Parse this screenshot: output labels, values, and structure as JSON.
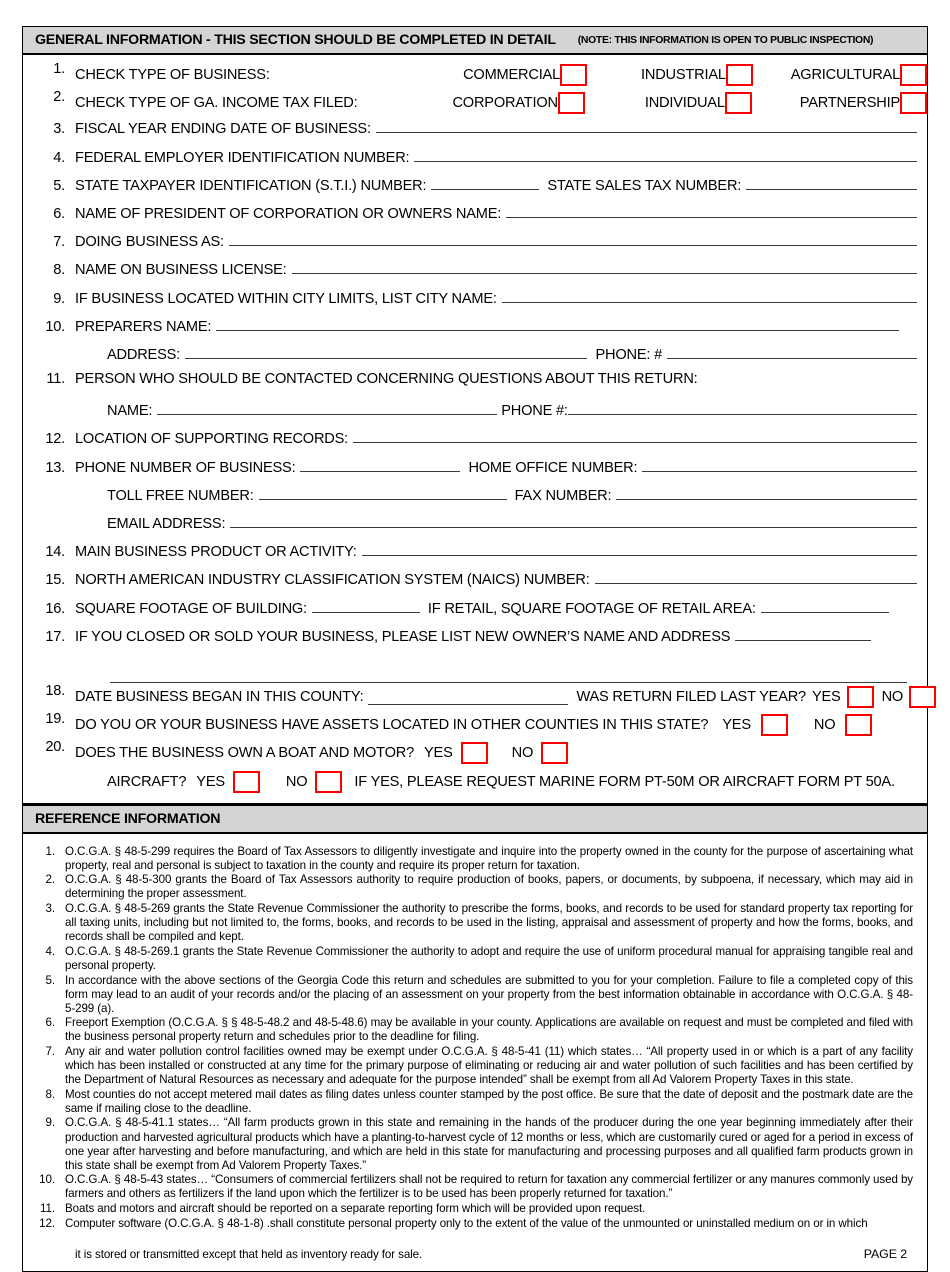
{
  "general_information": {
    "header_title": "GENERAL INFORMATION - THIS SECTION SHOULD BE COMPLETED IN DETAIL",
    "header_note": "(NOTE: THIS INFORMATION IS OPEN TO PUBLIC INSPECTION)",
    "items": {
      "n1": "1.",
      "n2": "2.",
      "n3": "3.",
      "n4": "4.",
      "n5": "5.",
      "n6": "6.",
      "n7": "7.",
      "n8": "8.",
      "n9": "9.",
      "n10": "10.",
      "n11": "11.",
      "n12": "12.",
      "n13": "13.",
      "n14": "14.",
      "n15": "15.",
      "n16": "16.",
      "n17": "17.",
      "n18": "18.",
      "n19": "19.",
      "n20": "20."
    },
    "labels": {
      "business_type": "CHECK TYPE OF BUSINESS:",
      "commercial": "COMMERCIAL",
      "industrial": "INDUSTRIAL",
      "agricultural": "AGRICULTURAL",
      "income_tax_type": "CHECK TYPE OF GA. INCOME TAX FILED:",
      "corporation": "CORPORATION",
      "individual": "INDIVIDUAL",
      "partnership": "PARTNERSHIP",
      "fiscal_year": "FISCAL YEAR ENDING DATE OF BUSINESS:",
      "fein": "FEDERAL EMPLOYER IDENTIFICATION NUMBER:",
      "sti": "STATE TAXPAYER IDENTIFICATION (S.T.I.) NUMBER:",
      "state_sales_tax": "STATE SALES TAX NUMBER:",
      "president_name": "NAME OF PRESIDENT OF CORPORATION OR OWNERS NAME:",
      "dba": "DOING BUSINESS AS:",
      "business_license_name": "NAME ON BUSINESS LICENSE:",
      "city_limits": "IF BUSINESS LOCATED WITHIN CITY LIMITS, LIST CITY NAME:",
      "preparers_name": "PREPARERS NAME:",
      "address": "ADDRESS:",
      "phone_hash": "PHONE: #",
      "contact_person": "PERSON WHO SHOULD BE CONTACTED CONCERNING QUESTIONS ABOUT THIS RETURN:",
      "name": "NAME:",
      "phone_num": "PHONE #:",
      "records_location": "LOCATION OF SUPPORTING RECORDS:",
      "business_phone": "PHONE NUMBER OF BUSINESS:",
      "home_office": "HOME OFFICE NUMBER:",
      "toll_free": "TOLL FREE NUMBER:",
      "fax": "FAX NUMBER:",
      "email": "EMAIL ADDRESS:",
      "main_product": "MAIN BUSINESS PRODUCT OR ACTIVITY:",
      "naics": "NORTH AMERICAN INDUSTRY CLASSIFICATION SYSTEM (NAICS) NUMBER:",
      "square_footage": "SQUARE FOOTAGE OF BUILDING:",
      "retail_footage": "IF RETAIL, SQUARE FOOTAGE OF RETAIL AREA:",
      "closed_sold": "IF YOU CLOSED OR SOLD YOUR BUSINESS, PLEASE LIST NEW OWNER’S NAME AND ADDRESS",
      "date_began": "DATE BUSINESS BEGAN IN THIS COUNTY:",
      "return_filed_last_year": "WAS RETURN FILED LAST YEAR?",
      "assets_other_counties": "DO YOU OR YOUR BUSINESS HAVE ASSETS LOCATED IN OTHER COUNTIES IN THIS STATE?",
      "boat_motor": "DOES THE BUSINESS OWN A BOAT AND MOTOR?",
      "aircraft": "AIRCRAFT?",
      "marine_note": "IF YES, PLEASE REQUEST MARINE FORM PT-50M OR AIRCRAFT FORM PT 50A.",
      "yes": "YES",
      "no": "NO"
    }
  },
  "reference_information": {
    "header_title": "REFERENCE INFORMATION",
    "items": [
      {
        "n": "1.",
        "text": "O.C.G.A. § 48-5-299 requires the Board of Tax Assessors to diligently investigate and inquire into the property owned in the county for the purpose of ascertaining what property, real and personal is subject to taxation in the county and require its proper return for taxation."
      },
      {
        "n": "2.",
        "text": "O.C.G.A. § 48-5-300 grants the Board of Tax Assessors authority to require production of books, papers, or documents, by subpoena, if necessary, which may aid in determining the proper assessment."
      },
      {
        "n": "3.",
        "text": "O.C.G.A. § 48-5-269 grants the State Revenue Commissioner the authority to prescribe the forms, books, and records to be used for standard property tax reporting for all taxing units, including but not limited to, the forms, books, and records to be used in the listing, appraisal and assessment of property and how the forms, books, and records shall be compiled and kept."
      },
      {
        "n": "4.",
        "text": "O.C.G.A. § 48-5-269.1 grants the State Revenue Commissioner the authority to adopt and require the use of uniform procedural manual for appraising tangible real and personal property."
      },
      {
        "n": "5.",
        "text": "In accordance with the above sections of the Georgia Code this return and schedules are submitted to you for your completion. Failure to file a completed copy of this form may lead to an audit of your records and/or the placing of an assessment on your property from the best information obtainable in accordance with O.C.G.A. § 48-5-299 (a)."
      },
      {
        "n": "6.",
        "text": "Freeport Exemption (O.C.G.A. § § 48-5-48.2 and 48-5-48.6) may be available in your county. Applications are available on request and must be completed and filed with the business personal property return and schedules prior to the deadline for filing."
      },
      {
        "n": "7.",
        "text": "Any air and water pollution control facilities owned may be exempt under O.C.G.A. § 48-5-41 (11) which states… “All property used in or which is a part of any facility which has been installed or constructed at any time for the primary purpose of eliminating or reducing air and water pollution of such facilities and has been certified by the Department of Natural Resources as necessary and adequate for the purpose intended” shall be exempt from all Ad Valorem Property Taxes in this state."
      },
      {
        "n": "8.",
        "text": "Most counties do not accept metered mail dates as filing dates unless counter stamped by the post office. Be sure that the date of deposit and the postmark date are the same if mailing close to the deadline."
      },
      {
        "n": "9.",
        "text": "O.C.G.A. § 48-5-41.1 states… “All farm products grown in this state and remaining in the hands of the producer during the one year beginning immediately after their production and harvested agricultural products which have a planting-to-harvest cycle of 12 months or less, which are customarily cured or aged for a period in excess of one year after harvesting and before manufacturing, and which are held in this state for manufacturing and processing purposes and all qualified farm products grown in this state shall be exempt from Ad Valorem Property Taxes.”"
      },
      {
        "n": "10.",
        "text": "O.C.G.A. § 48-5-43 states… “Consumers of commercial fertilizers shall not be required to return for taxation any commercial fertilizer or any manures commonly used by farmers and others as fertilizers if the land upon which the fertilizer is to be used has been properly returned for taxation.”"
      },
      {
        "n": "11.",
        "text": "Boats and motors and aircraft should be reported on a separate reporting form which will be provided upon request."
      },
      {
        "n": "12.",
        "text": "Computer software (O.C.G.A. § 48-1-8) .shall constitute personal property only to the extent of the value of the unmounted or uninstalled medium on or in which"
      }
    ],
    "tail_text": "it is stored or transmitted except that held as inventory ready for sale.",
    "page_label": "PAGE 2"
  },
  "colors": {
    "checkbox_border": "#ff0000",
    "header_background": "#d4d4d4",
    "rule_line": "#3a3a3a"
  }
}
